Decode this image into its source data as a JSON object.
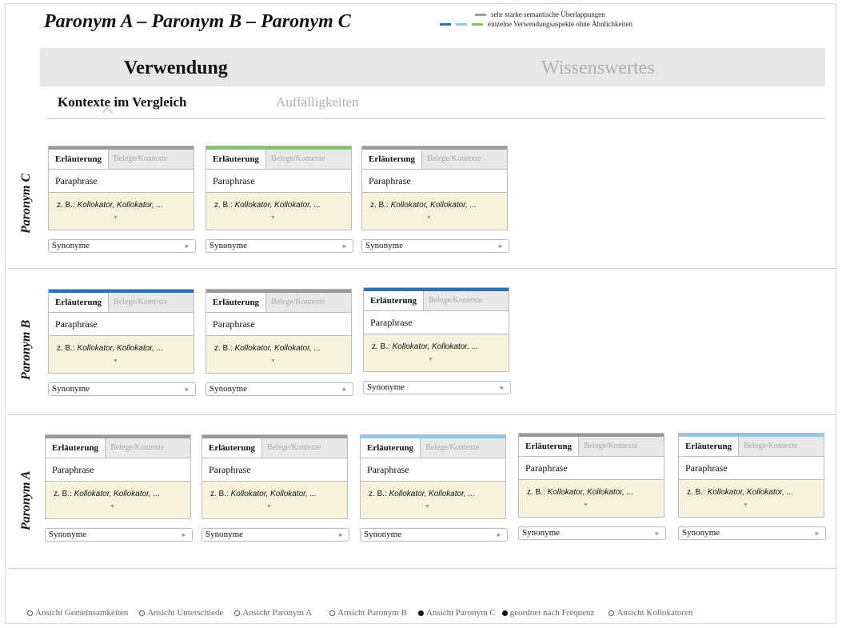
{
  "title": "Paronym A – Paronym B – Paronym C",
  "legend": {
    "overlap_label": "sehr starke semantische Überlappungen",
    "single_label": "einzelne Verwendungsaspekte ohne Ähnlichkeiten",
    "colors": {
      "gray": "#9a9a9a",
      "darkblue": "#2e6fad",
      "lightblue": "#8fc8e8",
      "green": "#7ec36a"
    }
  },
  "main_tabs": {
    "active": "Verwendung",
    "inactive": "Wissenswertes"
  },
  "sub_tabs": {
    "active": "Kontexte im Vergleich",
    "inactive": "Auffälligkeiten"
  },
  "rows": {
    "c": "Paronym C",
    "b": "Paronym B",
    "a": "Paronym A"
  },
  "card": {
    "tab_active": "Erläuterung",
    "tab_inactive": "Belege/Kontexte",
    "paraphrase": "Paraphrase",
    "example_prefix": "z. B.: ",
    "example_collocators": "Kollokator, Kollokator, ...",
    "synonyms": "Synonyme"
  },
  "bottom_options": [
    {
      "label": "Ansicht Gemeinsamkeiten",
      "selected": false
    },
    {
      "label": "Ansicht Unterschiede",
      "selected": false
    },
    {
      "label": "Ansicht Paronym A",
      "selected": false
    },
    {
      "label": "Ansicht Paronym B",
      "selected": false
    },
    {
      "label": "Ansicht Paronym C",
      "selected": true
    },
    {
      "label": "geordnet nach  Frequenz",
      "selected": true
    },
    {
      "label": "Ansicht Kollokatoren",
      "selected": false
    }
  ]
}
